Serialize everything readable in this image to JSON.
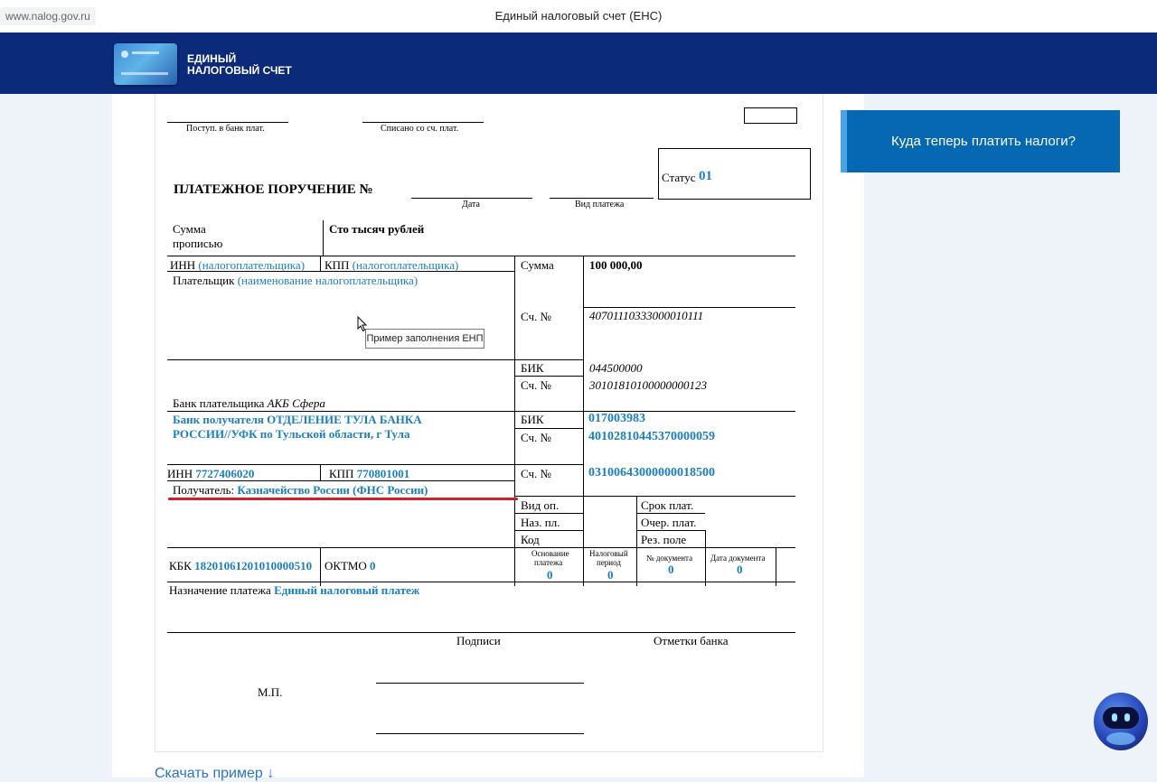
{
  "browser": {
    "url": "www.nalog.gov.ru",
    "page_title": "Единый налоговый счет (ЕНС)"
  },
  "header": {
    "brand_line1": "ЕДИНЫЙ",
    "brand_line2": "НАЛОГОВЫЙ СЧЕТ"
  },
  "sidebar": {
    "where_to_pay_button": "Куда теперь платить налоги?"
  },
  "tooltip": "Пример заполнения ЕНП",
  "download_link": "Скачать пример ↓",
  "form": {
    "received_label": "Поступ. в банк плат.",
    "debited_label": "Списано со сч. плат.",
    "title": "ПЛАТЕЖНОЕ ПОРУЧЕНИЕ №",
    "date_label": "Дата",
    "payment_type_label": "Вид платежа",
    "status_label": "Статус",
    "status_value": "01",
    "amount_words_label_1": "Сумма",
    "amount_words_label_2": "прописью",
    "amount_words_value": "Сто тысяч рублей",
    "payer_inn_label": "ИНН",
    "payer_inn_hint": "(налогоплательщика)",
    "payer_kpp_label": "КПП",
    "payer_kpp_hint": "(налогоплательщика)",
    "sum_label": "Сумма",
    "sum_value": "100 000,00",
    "payer_label": "Плательщик",
    "payer_hint": "(наименование налогоплательщика)",
    "payer_account_label": "Сч. №",
    "payer_account_value": "40701110333000010111",
    "payer_bik_label": "БИК",
    "payer_bik_value": "044500000",
    "payer_corr_label": "Сч. №",
    "payer_corr_value": "30101810100000000123",
    "payer_bank_label": "Банк плательщика",
    "payer_bank_value": "АКБ Сфера",
    "recipient_bank_line1": "Банк получателя ОТДЕЛЕНИЕ ТУЛА БАНКА",
    "recipient_bank_line2": "РОССИИ//УФК по Тульской области, г Тула",
    "recipient_bik_label": "БИК",
    "recipient_bik_value": "017003983",
    "recipient_corr_label": "Сч. №",
    "recipient_corr_value": "40102810445370000059",
    "recipient_inn_label": "ИНН",
    "recipient_inn_value": "7727406020",
    "recipient_kpp_label": "КПП",
    "recipient_kpp_value": "770801001",
    "recipient_account_label": "Сч. №",
    "recipient_account_value": "03100643000000018500",
    "recipient_label": "Получатель:",
    "recipient_value": "Казначейство России (ФНС России)",
    "op_type_label": "Вид оп.",
    "due_label": "Срок плат.",
    "purpose_code_label": "Наз. пл.",
    "order_label": "Очер. плат.",
    "code_label": "Код",
    "reserve_label": "Рез. поле",
    "kbk_label": "КБК",
    "kbk_value": "18201061201010000510",
    "oktmo_label": "ОКТМО",
    "oktmo_value": "0",
    "basis_label_1": "Основание",
    "basis_label_2": "платежа",
    "basis_value": "0",
    "period_label_1": "Налоговый",
    "period_label_2": "период",
    "period_value": "0",
    "docnum_label": "№ документа",
    "docnum_value": "0",
    "docdate_label": "Дата документа",
    "docdate_value": "0",
    "purpose_label": "Назначение платежа",
    "purpose_value": "Единый налоговый платеж",
    "signatures_label": "Подписи",
    "bank_marks_label": "Отметки банка",
    "stamp_label": "М.П."
  }
}
